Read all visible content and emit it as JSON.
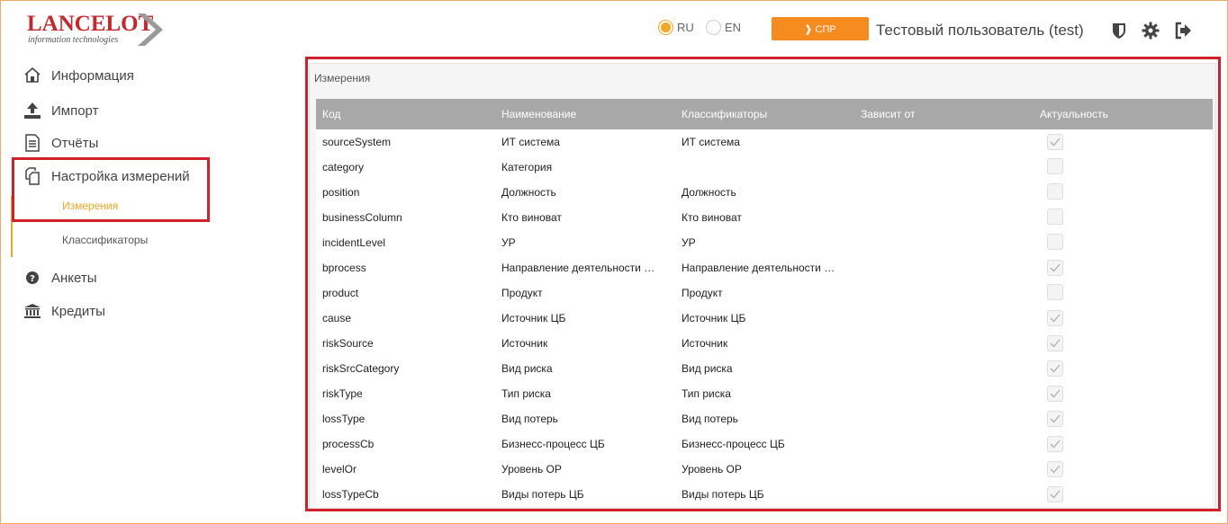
{
  "header": {
    "logo_text": "LANCELOT",
    "logo_sub": "information technologies",
    "lang_ru": "RU",
    "lang_en": "EN",
    "selected_lang": "RU",
    "spr_label": "❱ СПР",
    "user_name": "Тестовый пользователь (test)",
    "icons": [
      "shield-icon",
      "gear-icon",
      "logout-icon"
    ]
  },
  "sidebar": {
    "items": [
      {
        "label": "Информация",
        "icon": "home-icon"
      },
      {
        "label": "Импорт",
        "icon": "upload-icon"
      },
      {
        "label": "Отчёты",
        "icon": "report-icon"
      },
      {
        "label": "Настройка измерений",
        "icon": "copy-icon"
      },
      {
        "label": "Анкеты",
        "icon": "question-icon"
      },
      {
        "label": "Кредиты",
        "icon": "bank-icon"
      }
    ],
    "sub_items": [
      {
        "label": "Измерения",
        "active": true
      },
      {
        "label": "Классификаторы",
        "active": false
      }
    ]
  },
  "panel": {
    "title": "Измерения",
    "columns": [
      "Код",
      "Наименование",
      "Классификаторы",
      "Зависит от",
      "Актуальность"
    ],
    "rows": [
      {
        "code": "sourceSystem",
        "name": "ИТ система",
        "classifier": "ИТ система",
        "depends": "",
        "actual": true
      },
      {
        "code": "category",
        "name": "Категория",
        "classifier": "",
        "depends": "",
        "actual": false
      },
      {
        "code": "position",
        "name": "Должность",
        "classifier": "Должность",
        "depends": "",
        "actual": false
      },
      {
        "code": "businessColumn",
        "name": "Кто виноват",
        "classifier": "Кто виноват",
        "depends": "",
        "actual": false
      },
      {
        "code": "incidentLevel",
        "name": "УР",
        "classifier": "УР",
        "depends": "",
        "actual": false
      },
      {
        "code": "bprocess",
        "name": "Направление деятельности …",
        "classifier": "Направление деятельности …",
        "depends": "",
        "actual": true
      },
      {
        "code": "product",
        "name": "Продукт",
        "classifier": "Продукт",
        "depends": "",
        "actual": false
      },
      {
        "code": "cause",
        "name": "Источник ЦБ",
        "classifier": "Источник ЦБ",
        "depends": "",
        "actual": true
      },
      {
        "code": "riskSource",
        "name": "Источник",
        "classifier": "Источник",
        "depends": "",
        "actual": true
      },
      {
        "code": "riskSrcCategory",
        "name": "Вид риска",
        "classifier": "Вид риска",
        "depends": "",
        "actual": true
      },
      {
        "code": "riskType",
        "name": "Тип риска",
        "classifier": "Тип риска",
        "depends": "",
        "actual": true
      },
      {
        "code": "lossType",
        "name": "Вид потерь",
        "classifier": "Вид потерь",
        "depends": "",
        "actual": true
      },
      {
        "code": "processCb",
        "name": "Бизнесс-процесс ЦБ",
        "classifier": "Бизнесс-процесс ЦБ",
        "depends": "",
        "actual": true
      },
      {
        "code": "levelOr",
        "name": "Уровень ОР",
        "classifier": "Уровень ОР",
        "depends": "",
        "actual": true
      },
      {
        "code": "lossTypeCb",
        "name": "Виды потерь ЦБ",
        "classifier": "Виды потерь ЦБ",
        "depends": "",
        "actual": true
      }
    ]
  },
  "colors": {
    "accent": "#f5a623",
    "button": "#f68b1f",
    "highlight": "#d0202a",
    "logo": "#c8262b",
    "grid_header": "#a8a8a8"
  }
}
